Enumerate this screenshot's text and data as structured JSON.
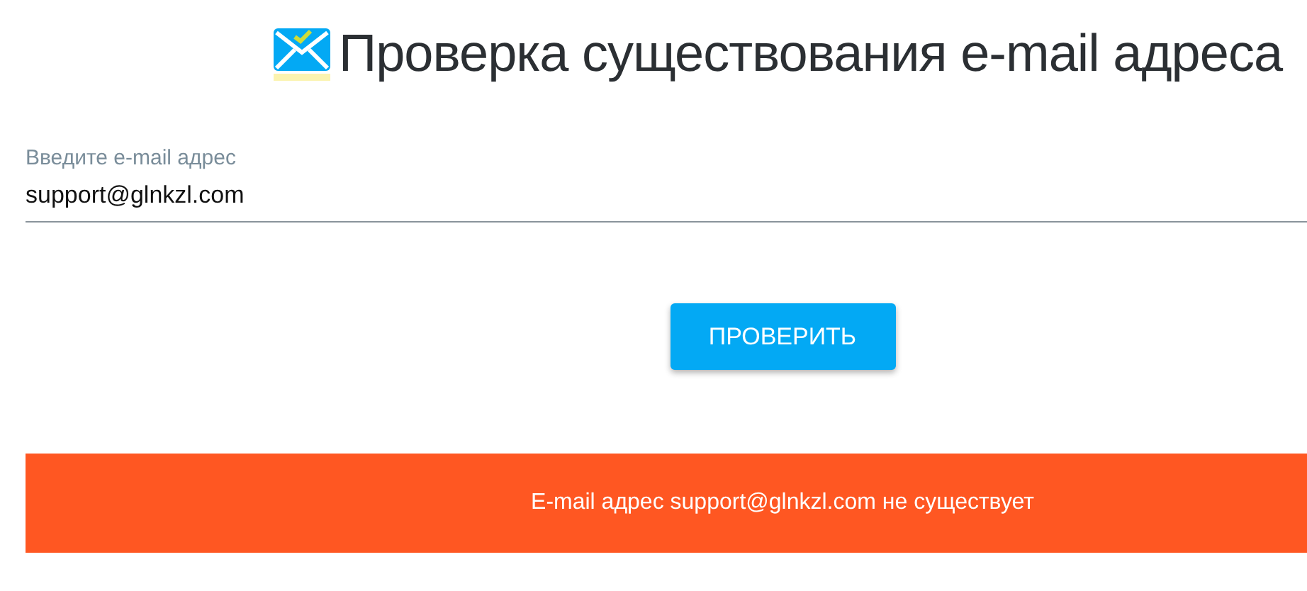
{
  "title": "Проверка существования e-mail адреса",
  "email_field": {
    "label": "Введите e-mail адрес",
    "value": "support@glnkzl.com"
  },
  "check_button": "ПРОВЕРИТЬ",
  "result": {
    "kind": "error",
    "text": "E-mail адрес support@glnkzl.com не существует"
  }
}
